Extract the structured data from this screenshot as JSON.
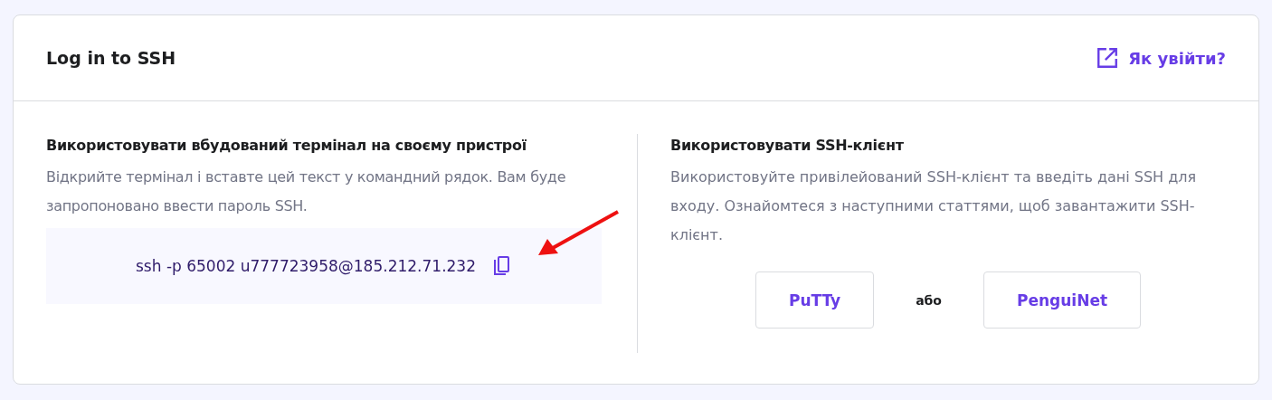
{
  "card": {
    "title": "Log in to SSH",
    "help_link": "Як увійти?"
  },
  "terminal": {
    "heading": "Використовувати вбудований термінал на своєму пристрої",
    "description": "Відкрийте термінал і вставте цей текст у командний рядок. Вам буде запропоновано ввести пароль SSH.",
    "command": "ssh -p 65002 u777723958@185.212.71.232"
  },
  "client": {
    "heading": "Використовувати SSH-клієнт",
    "description": "Використовуйте привілейований SSH-клієнт та введіть дані SSH для входу. Ознайомтеся з наступними статтями, щоб завантажити SSH-клієнт.",
    "buttons": [
      {
        "kind": "button",
        "label": "PuTTy"
      },
      {
        "kind": "separator",
        "label": "або"
      },
      {
        "kind": "button",
        "label": "PenguiNet"
      }
    ]
  }
}
